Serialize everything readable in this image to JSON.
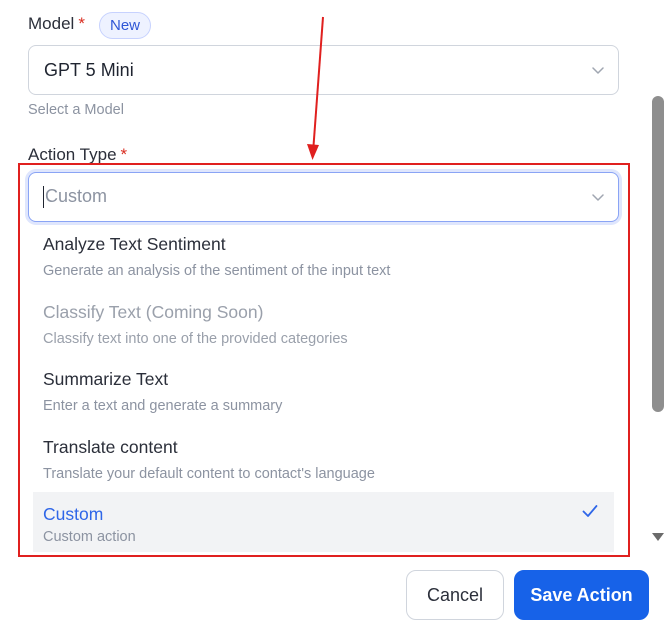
{
  "model": {
    "label": "Model",
    "required_mark": "*",
    "badge": "New",
    "selected": "GPT 5 Mini",
    "hint": "Select a Model"
  },
  "action_type": {
    "label": "Action Type",
    "required_mark": "*",
    "input_value": "Custom",
    "options": [
      {
        "title": "Analyze Text Sentiment",
        "desc": "Generate an analysis of the sentiment of the input text"
      },
      {
        "title": "Classify Text (Coming Soon)",
        "desc": "Classify text into one of the provided categories"
      },
      {
        "title": "Summarize Text",
        "desc": "Enter a text and generate a summary"
      },
      {
        "title": "Translate content",
        "desc": "Translate your default content to contact's language"
      },
      {
        "title": "Custom",
        "desc": "Custom action"
      }
    ]
  },
  "footer": {
    "cancel_label": "Cancel",
    "save_label": "Save Action"
  },
  "colors": {
    "accent": "#1762e8",
    "selected_text": "#2f66e8",
    "annotation": "#e0201f",
    "required": "#d92d20"
  },
  "icons": [
    "chevron-down-icon",
    "checkmark-icon",
    "annotation-arrow"
  ]
}
